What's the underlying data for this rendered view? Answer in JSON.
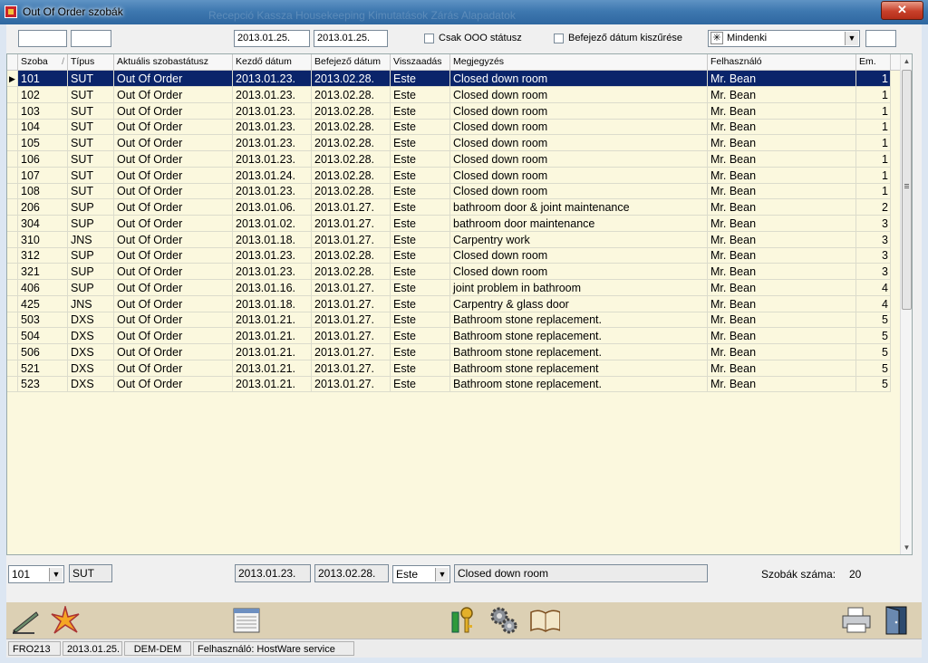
{
  "window": {
    "title": "Out Of Order szobák",
    "bg_menu": "Recepció      Kassza      Housekeeping      Kimutatások      Zárás      Alapadatok"
  },
  "filters": {
    "room_from": "",
    "room_to": "",
    "date_from": "2013.01.25.",
    "date_to": "2013.01.25.",
    "only_ooo_label": "Csak OOO státusz",
    "end_date_filter_label": "Befejező dátum kiszűrése",
    "user_filter_value": "Mindenki",
    "user_filter_icon": "asterisk-icon",
    "extra": ""
  },
  "columns": [
    "Szoba",
    "Típus",
    "Aktuális szobastátusz",
    "Kezdő dátum",
    "Befejező dátum",
    "Visszaadás",
    "Megjegyzés",
    "Felhasználó",
    "Em."
  ],
  "sort_indicator": "/",
  "rows": [
    [
      "101",
      "SUT",
      "Out Of Order",
      "2013.01.23.",
      "2013.02.28.",
      "Este",
      "Closed down room",
      "Mr. Bean",
      "1"
    ],
    [
      "102",
      "SUT",
      "Out Of Order",
      "2013.01.23.",
      "2013.02.28.",
      "Este",
      "Closed down room",
      "Mr. Bean",
      "1"
    ],
    [
      "103",
      "SUT",
      "Out Of Order",
      "2013.01.23.",
      "2013.02.28.",
      "Este",
      "Closed down room",
      "Mr. Bean",
      "1"
    ],
    [
      "104",
      "SUT",
      "Out Of Order",
      "2013.01.23.",
      "2013.02.28.",
      "Este",
      "Closed down room",
      "Mr. Bean",
      "1"
    ],
    [
      "105",
      "SUT",
      "Out Of Order",
      "2013.01.23.",
      "2013.02.28.",
      "Este",
      "Closed down room",
      "Mr. Bean",
      "1"
    ],
    [
      "106",
      "SUT",
      "Out Of Order",
      "2013.01.23.",
      "2013.02.28.",
      "Este",
      "Closed down room",
      "Mr. Bean",
      "1"
    ],
    [
      "107",
      "SUT",
      "Out Of Order",
      "2013.01.24.",
      "2013.02.28.",
      "Este",
      "Closed down room",
      "Mr. Bean",
      "1"
    ],
    [
      "108",
      "SUT",
      "Out Of Order",
      "2013.01.23.",
      "2013.02.28.",
      "Este",
      "Closed down room",
      "Mr. Bean",
      "1"
    ],
    [
      "206",
      "SUP",
      "Out Of Order",
      "2013.01.06.",
      "2013.01.27.",
      "Este",
      "bathroom door & joint maintenance",
      "Mr. Bean",
      "2"
    ],
    [
      "304",
      "SUP",
      "Out Of Order",
      "2013.01.02.",
      "2013.01.27.",
      "Este",
      "bathroom door maintenance",
      "Mr. Bean",
      "3"
    ],
    [
      "310",
      "JNS",
      "Out Of Order",
      "2013.01.18.",
      "2013.01.27.",
      "Este",
      "Carpentry work",
      "Mr. Bean",
      "3"
    ],
    [
      "312",
      "SUP",
      "Out Of Order",
      "2013.01.23.",
      "2013.02.28.",
      "Este",
      "Closed down room",
      "Mr. Bean",
      "3"
    ],
    [
      "321",
      "SUP",
      "Out Of Order",
      "2013.01.23.",
      "2013.02.28.",
      "Este",
      "Closed down room",
      "Mr. Bean",
      "3"
    ],
    [
      "406",
      "SUP",
      "Out Of Order",
      "2013.01.16.",
      "2013.01.27.",
      "Este",
      "joint problem in bathroom",
      "Mr. Bean",
      "4"
    ],
    [
      "425",
      "JNS",
      "Out Of Order",
      "2013.01.18.",
      "2013.01.27.",
      "Este",
      "Carpentry & glass door",
      "Mr. Bean",
      "4"
    ],
    [
      "503",
      "DXS",
      "Out Of Order",
      "2013.01.21.",
      "2013.01.27.",
      "Este",
      "Bathroom stone replacement.",
      "Mr. Bean",
      "5"
    ],
    [
      "504",
      "DXS",
      "Out Of Order",
      "2013.01.21.",
      "2013.01.27.",
      "Este",
      "Bathroom stone replacement.",
      "Mr. Bean",
      "5"
    ],
    [
      "506",
      "DXS",
      "Out Of Order",
      "2013.01.21.",
      "2013.01.27.",
      "Este",
      "Bathroom stone replacement.",
      "Mr. Bean",
      "5"
    ],
    [
      "521",
      "DXS",
      "Out Of Order",
      "2013.01.21.",
      "2013.01.27.",
      "Este",
      "Bathroom stone replacement",
      "Mr. Bean",
      "5"
    ],
    [
      "523",
      "DXS",
      "Out Of Order",
      "2013.01.21.",
      "2013.01.27.",
      "Este",
      "Bathroom stone replacement.",
      "Mr. Bean",
      "5"
    ]
  ],
  "selected_row": 0,
  "editor": {
    "room": "101",
    "type": "SUT",
    "start": "2013.01.23.",
    "end": "2013.02.28.",
    "return": "Este",
    "note": "Closed down room",
    "count_label": "Szobák száma:",
    "count_value": "20"
  },
  "toolbar": [
    "edit-icon",
    "star-new-icon",
    "calendar-list-icon",
    "keys-icon",
    "gears-icon",
    "book-icon",
    "printer-icon",
    "exit-door-icon"
  ],
  "status": {
    "terminal": "FRO213",
    "date": "2013.01.25.",
    "db": "DEM-DEM",
    "user": "Felhasználó: HostWare service"
  },
  "colors": {
    "grid_bg": "#fbf8de",
    "selection": "#0a246a",
    "toolbar_bg": "#dcd0b4"
  }
}
